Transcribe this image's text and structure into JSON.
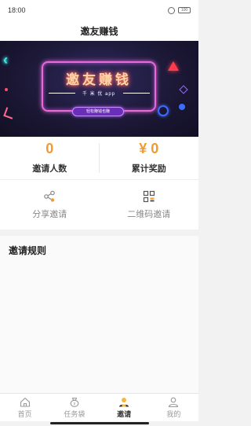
{
  "status": {
    "time": "18:00",
    "battery": "100"
  },
  "header": {
    "title": "邀友赚钱"
  },
  "banner": {
    "title": "邀友赚钱",
    "subtitle": "千 米 优 app",
    "button": "轻松赚钱也赚",
    "colors": {
      "bg": "#1c1836",
      "neon_pink": "#e86ad9",
      "cyan": "#38e8e0"
    }
  },
  "stats": {
    "invites": {
      "value": "0",
      "label": "邀请人数"
    },
    "rewards": {
      "value": "¥ 0",
      "label": "累计奖励"
    }
  },
  "actions": [
    {
      "label": "分享邀请",
      "icon": "share-icon"
    },
    {
      "label": "二维码邀请",
      "icon": "qrcode-icon"
    }
  ],
  "rules": {
    "title": "邀请规则"
  },
  "tabs": [
    {
      "label": "首页",
      "icon": "home-icon"
    },
    {
      "label": "任务袋",
      "icon": "task-bag-icon"
    },
    {
      "label": "邀请",
      "icon": "invite-icon",
      "active": true
    },
    {
      "label": "我的",
      "icon": "profile-icon"
    }
  ],
  "accent": "#f39a2e"
}
